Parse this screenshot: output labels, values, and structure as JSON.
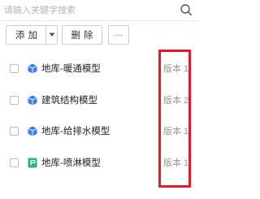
{
  "search": {
    "placeholder": "请输入关键字搜索",
    "value": ""
  },
  "toolbar": {
    "add_label": "添加",
    "delete_label": "删除",
    "more_label": "···"
  },
  "icons": {
    "search": "search-icon",
    "dropdown": "caret-down-icon",
    "model_blue": "cube-model-icon",
    "model_green": "green-model-icon"
  },
  "colors": {
    "highlight": "#e8192c",
    "icon_blue": "#3d7ef5",
    "icon_green": "#23b38a"
  },
  "items": [
    {
      "name": "地库-暖通模型",
      "version": "版本 1",
      "icon": "cube-model-icon"
    },
    {
      "name": "建筑结构模型",
      "version": "版本 2",
      "icon": "cube-model-icon"
    },
    {
      "name": "地库-给排水模型",
      "version": "版本 1",
      "icon": "cube-model-icon"
    },
    {
      "name": "地库-喷淋模型",
      "version": "版本 1",
      "icon": "green-model-icon"
    }
  ]
}
